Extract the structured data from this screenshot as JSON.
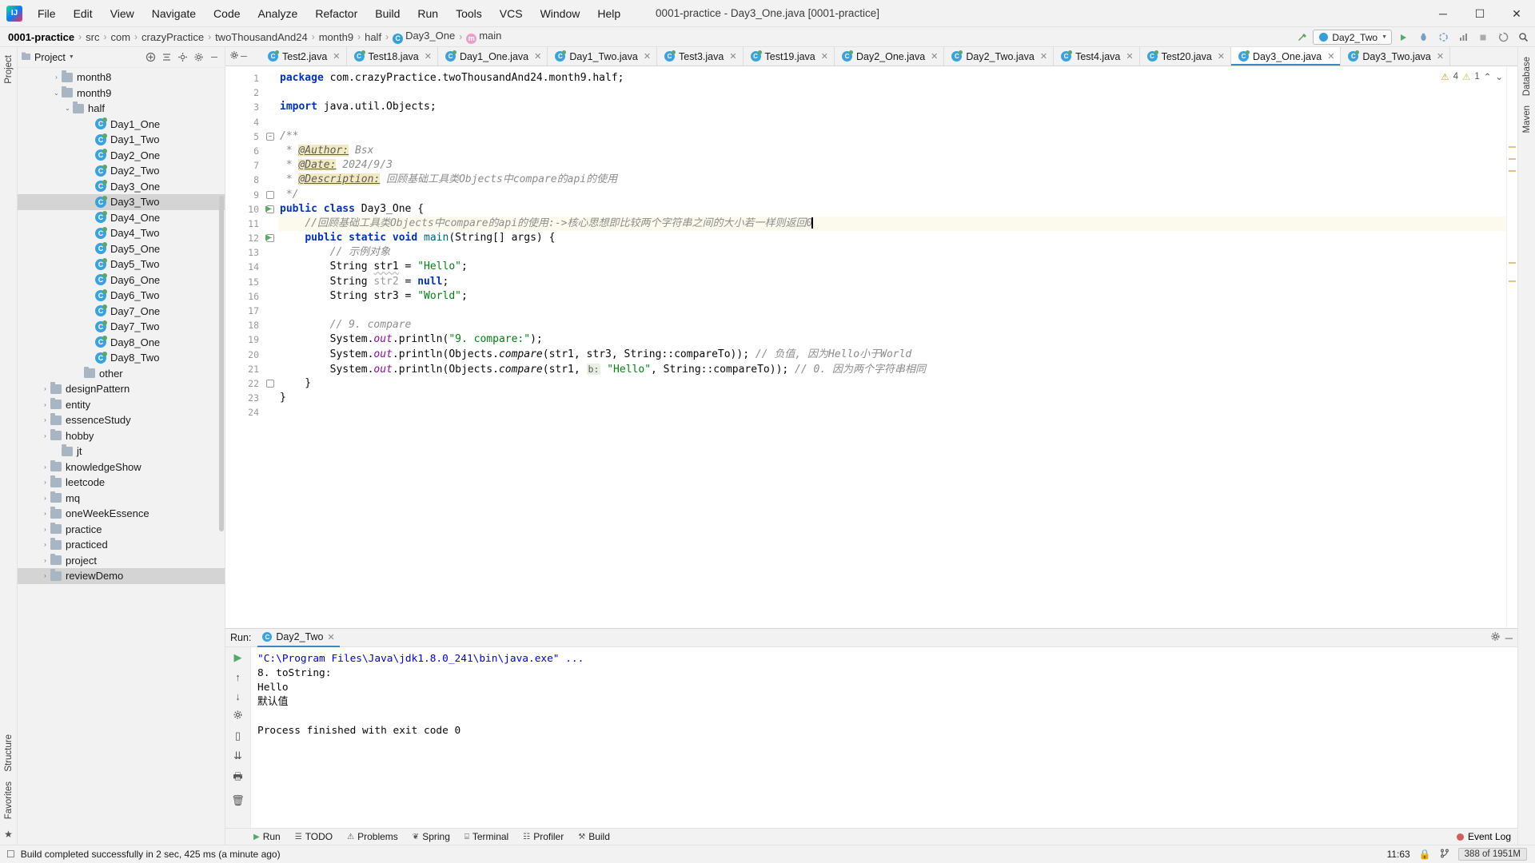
{
  "window": {
    "title": "0001-practice - Day3_One.java [0001-practice]",
    "logo_text": "IJ",
    "minimize": "─",
    "maximize": "☐",
    "close": "✕"
  },
  "menu": [
    "File",
    "Edit",
    "View",
    "Navigate",
    "Code",
    "Analyze",
    "Refactor",
    "Build",
    "Run",
    "Tools",
    "VCS",
    "Window",
    "Help"
  ],
  "breadcrumb": [
    {
      "label": "0001-practice",
      "icon": ""
    },
    {
      "label": "src",
      "icon": ""
    },
    {
      "label": "com",
      "icon": ""
    },
    {
      "label": "crazyPractice",
      "icon": ""
    },
    {
      "label": "twoThousandAnd24",
      "icon": ""
    },
    {
      "label": "month9",
      "icon": ""
    },
    {
      "label": "half",
      "icon": ""
    },
    {
      "label": "Day3_One",
      "icon": "class-icon"
    },
    {
      "label": "main",
      "icon": "method-icon"
    }
  ],
  "toolbar": {
    "build_icon": "hammer-icon",
    "run_config": "Day2_Two",
    "run_icon": "play-icon",
    "debug_icon": "debug-icon",
    "coverage_icon": "run-coverage-icon",
    "profiler_icon": "profiler-icon",
    "stop_icon": "stop-icon",
    "search_icon": "search-icon",
    "updates_icon": "updates-icon"
  },
  "left_strip": {
    "tabs": [
      "Project"
    ],
    "bottom_tabs": [
      "Structure",
      "Favorites"
    ],
    "bottom_icon": "star-icon"
  },
  "right_strip": {
    "tabs": [
      "Database",
      "Maven"
    ]
  },
  "project_panel": {
    "title": "Project",
    "header_icons": [
      "expand-icon",
      "collapse-all-icon",
      "locate-icon",
      "settings-icon",
      "hide-icon"
    ],
    "tree": [
      {
        "label": "month8",
        "type": "folder",
        "indent": 3,
        "twist": "›",
        "selected": false
      },
      {
        "label": "month9",
        "type": "folder",
        "indent": 3,
        "twist": "⌄",
        "selected": false
      },
      {
        "label": "half",
        "type": "folder",
        "indent": 4,
        "twist": "⌄",
        "selected": false
      },
      {
        "label": "Day1_One",
        "type": "java",
        "indent": 6,
        "twist": "",
        "selected": false
      },
      {
        "label": "Day1_Two",
        "type": "java",
        "indent": 6,
        "twist": "",
        "selected": false
      },
      {
        "label": "Day2_One",
        "type": "java",
        "indent": 6,
        "twist": "",
        "selected": false
      },
      {
        "label": "Day2_Two",
        "type": "java",
        "indent": 6,
        "twist": "",
        "selected": false
      },
      {
        "label": "Day3_One",
        "type": "java",
        "indent": 6,
        "twist": "",
        "selected": false
      },
      {
        "label": "Day3_Two",
        "type": "java",
        "indent": 6,
        "twist": "",
        "selected": true
      },
      {
        "label": "Day4_One",
        "type": "java",
        "indent": 6,
        "twist": "",
        "selected": false
      },
      {
        "label": "Day4_Two",
        "type": "java",
        "indent": 6,
        "twist": "",
        "selected": false
      },
      {
        "label": "Day5_One",
        "type": "java",
        "indent": 6,
        "twist": "",
        "selected": false
      },
      {
        "label": "Day5_Two",
        "type": "java",
        "indent": 6,
        "twist": "",
        "selected": false
      },
      {
        "label": "Day6_One",
        "type": "java",
        "indent": 6,
        "twist": "",
        "selected": false
      },
      {
        "label": "Day6_Two",
        "type": "java",
        "indent": 6,
        "twist": "",
        "selected": false
      },
      {
        "label": "Day7_One",
        "type": "java",
        "indent": 6,
        "twist": "",
        "selected": false
      },
      {
        "label": "Day7_Two",
        "type": "java",
        "indent": 6,
        "twist": "",
        "selected": false
      },
      {
        "label": "Day8_One",
        "type": "java",
        "indent": 6,
        "twist": "",
        "selected": false
      },
      {
        "label": "Day8_Two",
        "type": "java",
        "indent": 6,
        "twist": "",
        "selected": false
      },
      {
        "label": "other",
        "type": "folder",
        "indent": 5,
        "twist": "",
        "selected": false
      },
      {
        "label": "designPattern",
        "type": "folder",
        "indent": 2,
        "twist": "›",
        "selected": false
      },
      {
        "label": "entity",
        "type": "folder",
        "indent": 2,
        "twist": "›",
        "selected": false
      },
      {
        "label": "essenceStudy",
        "type": "folder",
        "indent": 2,
        "twist": "›",
        "selected": false
      },
      {
        "label": "hobby",
        "type": "folder",
        "indent": 2,
        "twist": "›",
        "selected": false
      },
      {
        "label": "jt",
        "type": "folder",
        "indent": 3,
        "twist": "",
        "selected": false
      },
      {
        "label": "knowledgeShow",
        "type": "folder",
        "indent": 2,
        "twist": "›",
        "selected": false
      },
      {
        "label": "leetcode",
        "type": "folder",
        "indent": 2,
        "twist": "›",
        "selected": false
      },
      {
        "label": "mq",
        "type": "folder",
        "indent": 2,
        "twist": "›",
        "selected": false
      },
      {
        "label": "oneWeekEssence",
        "type": "folder",
        "indent": 2,
        "twist": "›",
        "selected": false
      },
      {
        "label": "practice",
        "type": "folder",
        "indent": 2,
        "twist": "›",
        "selected": false
      },
      {
        "label": "practiced",
        "type": "folder",
        "indent": 2,
        "twist": "›",
        "selected": false
      },
      {
        "label": "project",
        "type": "folder",
        "indent": 2,
        "twist": "›",
        "selected": false
      },
      {
        "label": "reviewDemo",
        "type": "folder",
        "indent": 2,
        "twist": "›",
        "selected": true
      }
    ]
  },
  "editor_tabs": [
    {
      "label": "Test2.java",
      "active": false
    },
    {
      "label": "Test18.java",
      "active": false
    },
    {
      "label": "Day1_One.java",
      "active": false
    },
    {
      "label": "Day1_Two.java",
      "active": false
    },
    {
      "label": "Test3.java",
      "active": false
    },
    {
      "label": "Test19.java",
      "active": false
    },
    {
      "label": "Day2_One.java",
      "active": false
    },
    {
      "label": "Day2_Two.java",
      "active": false
    },
    {
      "label": "Test4.java",
      "active": false
    },
    {
      "label": "Test20.java",
      "active": false
    },
    {
      "label": "Day3_One.java",
      "active": true
    },
    {
      "label": "Day3_Two.java",
      "active": false
    }
  ],
  "inspection": {
    "warnings": "4",
    "weak_warnings": "1",
    "up_arrow": "⌃",
    "down_arrow": "⌄"
  },
  "code": {
    "line_count": 24,
    "lines": [
      {
        "n": 1,
        "html": "<span class='kw'>package</span> com.crazyPractice.twoThousandAnd24.month9.half;"
      },
      {
        "n": 2,
        "html": ""
      },
      {
        "n": 3,
        "html": "<span class='kw'>import</span> java.util.Objects;"
      },
      {
        "n": 4,
        "html": ""
      },
      {
        "n": 5,
        "html": "<span class='doc'>/**</span>"
      },
      {
        "n": 6,
        "html": " <span class='doc'>*</span> <span class='doctag'>@Author:</span> <span class='doc'>Bsx</span>"
      },
      {
        "n": 7,
        "html": " <span class='doc'>*</span> <span class='doctag'>@Date:</span> <span class='doc'>2024/9/3</span>"
      },
      {
        "n": 8,
        "html": " <span class='doc'>*</span> <span class='doctag'>@Description:</span> <span class='doc'>回顾基础工具类Objects中compare的api的使用</span>"
      },
      {
        "n": 9,
        "html": " <span class='doc'>*/</span>"
      },
      {
        "n": 10,
        "html": "<span class='kw'>public class</span> Day3_One {"
      },
      {
        "n": 11,
        "html": "    <span class='cmt'>//回顾基础工具类Objects中compare的api的使用:-&gt;核心思想即比较两个字符串之间的大小若一样则返回0</span><span class='caret'></span>",
        "hl": true
      },
      {
        "n": 12,
        "html": "    <span class='kw'>public static void</span> <span class='meth'>main</span>(String[] args) {"
      },
      {
        "n": 13,
        "html": "        <span class='cmt'>// 示例对象</span>"
      },
      {
        "n": 14,
        "html": "        String <span class='wavy'>str1</span> = <span class='str'>\"Hello\"</span>;"
      },
      {
        "n": 15,
        "html": "        String <span style='color:#9a9a9a'>str2</span> = <span class='kw'>null</span>;"
      },
      {
        "n": 16,
        "html": "        String str3 = <span class='str'>\"World\"</span>;"
      },
      {
        "n": 17,
        "html": ""
      },
      {
        "n": 18,
        "html": "        <span class='cmt'>// 9. compare</span>"
      },
      {
        "n": 19,
        "html": "        System.<span class='fld'>out</span>.println(<span class='str'>\"9. compare:\"</span>);"
      },
      {
        "n": 20,
        "html": "        System.<span class='fld'>out</span>.println(Objects.<span style='font-style:italic'>compare</span>(str1, str3, String::compareTo)); <span class='cmt'>// 负值, 因为Hello小于World</span>"
      },
      {
        "n": 21,
        "html": "        System.<span class='fld'>out</span>.println(Objects.<span style='font-style:italic'>compare</span>(str1, <span class='hint'>b:</span> <span class='str'>\"Hello\"</span>, String::compareTo)); <span class='cmt'>// 0. 因为两个字符串相同</span>"
      },
      {
        "n": 22,
        "html": "    }"
      },
      {
        "n": 23,
        "html": "}"
      },
      {
        "n": 24,
        "html": ""
      }
    ],
    "run_markers": [
      10,
      12
    ]
  },
  "run_panel": {
    "label": "Run:",
    "tab": "Day2_Two",
    "close_icon": "✕",
    "settings_icon": "gear-icon",
    "hide_icon": "─",
    "sidebar_icons": [
      "rerun-icon",
      "up-icon",
      "down-icon",
      "settings-icon",
      "soft-wrap-icon",
      "scroll-to-end-icon",
      "print-icon",
      "clear-all-icon"
    ],
    "console": [
      {
        "text": "\"C:\\Program Files\\Java\\jdk1.8.0_241\\bin\\java.exe\" ...",
        "type": "cmd"
      },
      {
        "text": "8. toString:",
        "type": "out"
      },
      {
        "text": "Hello",
        "type": "out"
      },
      {
        "text": "默认值",
        "type": "out"
      },
      {
        "text": "",
        "type": "out"
      },
      {
        "text": "Process finished with exit code 0",
        "type": "out"
      }
    ]
  },
  "bottom_toolbar": {
    "items": [
      {
        "label": "Run",
        "icon": "play-icon",
        "active": true
      },
      {
        "label": "TODO",
        "icon": "list-icon",
        "active": false
      },
      {
        "label": "Problems",
        "icon": "problems-icon",
        "active": false
      },
      {
        "label": "Spring",
        "icon": "spring-icon",
        "active": false
      },
      {
        "label": "Terminal",
        "icon": "terminal-icon",
        "active": false
      },
      {
        "label": "Profiler",
        "icon": "profiler-icon",
        "active": false
      },
      {
        "label": "Build",
        "icon": "build-icon",
        "active": false
      }
    ],
    "event_log": "Event Log"
  },
  "status_bar": {
    "message": "Build completed successfully in 2 sec, 425 ms (a minute ago)",
    "position": "11:63",
    "lock_icon": "lock-icon",
    "branch_icon": "branch-icon",
    "memory": "388 of 1951M"
  }
}
